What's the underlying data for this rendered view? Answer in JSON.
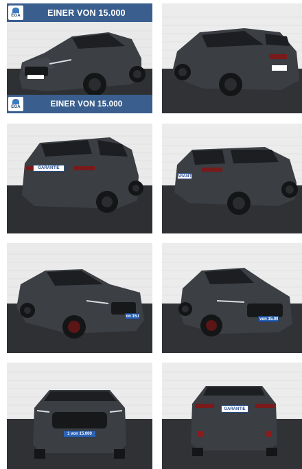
{
  "gallery": {
    "banner_top_text": "EINER VON 15.000",
    "banner_bottom_text": "EINER VON 15.000",
    "dealer_logo_text": "EGA",
    "plate_text_front": "1 von 15.000",
    "plate_text_rear": "GARANTIE",
    "plate_text_rear_2": "GARANTIE",
    "photos": [
      {
        "view": "front-three-quarter-right"
      },
      {
        "view": "rear-three-quarter-right"
      },
      {
        "view": "rear-three-quarter-left"
      },
      {
        "view": "rear-three-quarter-left-wide"
      },
      {
        "view": "front-three-quarter-right-close"
      },
      {
        "view": "front-three-quarter-left"
      },
      {
        "view": "front"
      },
      {
        "view": "rear"
      }
    ]
  },
  "colors": {
    "banner": "#3a5f8f",
    "car_body": "#3b3e43",
    "wall": "#ececec",
    "floor": "#2f3134"
  }
}
